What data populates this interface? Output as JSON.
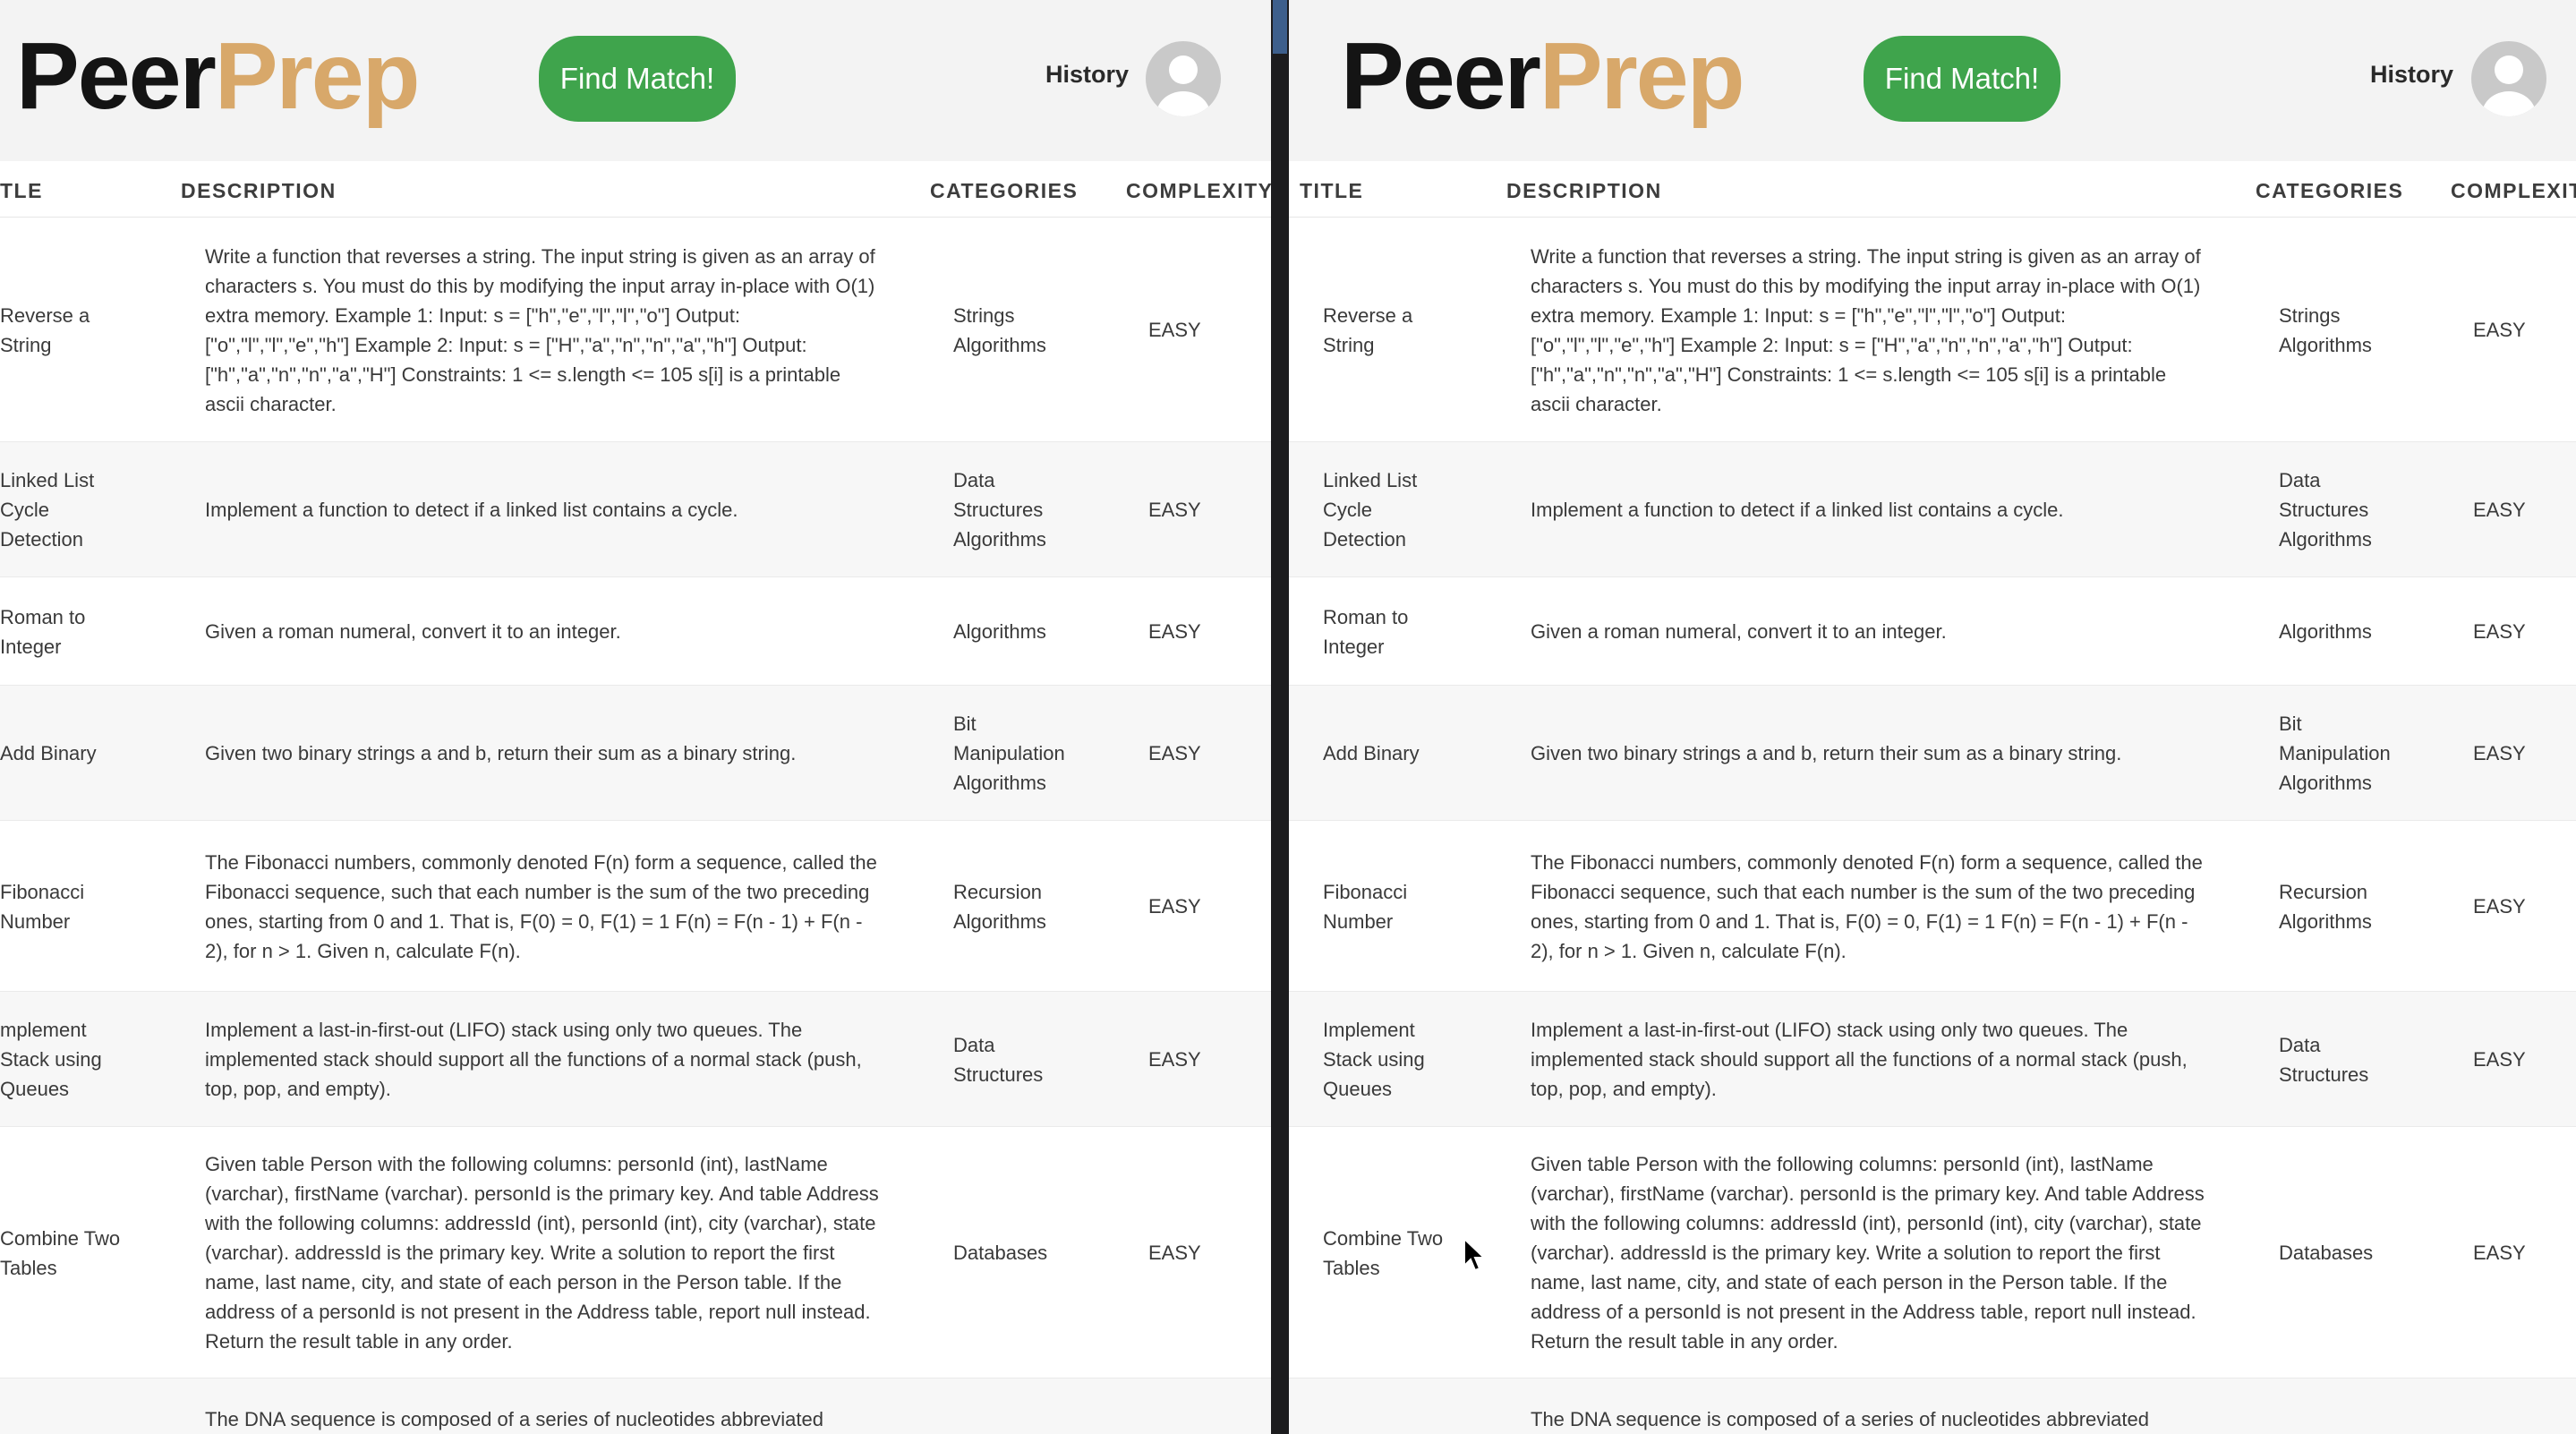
{
  "app": {
    "logo_part1": "Peer",
    "logo_part2": "Prep",
    "find_match_label": "Find Match!",
    "history_label": "History"
  },
  "columns": {
    "title": "TITLE",
    "title_left_cropped": "TLE",
    "description": "DESCRIPTION",
    "categories": "CATEGORIES",
    "complexity": "COMPLEXITY",
    "complexity_right_cropped": "COMPLEXIT"
  },
  "questions": [
    {
      "title": "Reverse a String",
      "title_left_cropped": "Reverse a String",
      "description": "Write a function that reverses a string. The input string is given as an array of characters s. You must do this by modifying the input array in-place with O(1) extra memory. Example 1: Input: s = [\"h\",\"e\",\"l\",\"l\",\"o\"] Output: [\"o\",\"l\",\"l\",\"e\",\"h\"] Example 2: Input: s = [\"H\",\"a\",\"n\",\"n\",\"a\",\"h\"] Output: [\"h\",\"a\",\"n\",\"n\",\"a\",\"H\"] Constraints: 1 <= s.length <= 105 s[i] is a printable ascii character.",
      "categories": "Strings Algorithms",
      "complexity": "EASY"
    },
    {
      "title": "Linked List Cycle Detection",
      "title_left_cropped": "Linked List Cycle Detection",
      "description": "Implement a function to detect if a linked list contains a cycle.",
      "categories": "Data Structures Algorithms",
      "complexity": "EASY"
    },
    {
      "title": "Roman to Integer",
      "title_left_cropped": "Roman to Integer",
      "description": "Given a roman numeral, convert it to an integer.",
      "categories": "Algorithms",
      "complexity": "EASY"
    },
    {
      "title": "Add Binary",
      "title_left_cropped": "Add Binary",
      "description": "Given two binary strings a and b, return their sum as a binary string.",
      "categories": "Bit Manipulation Algorithms",
      "complexity": "EASY"
    },
    {
      "title": "Fibonacci Number",
      "title_left_cropped": "Fibonacci Number",
      "description": "The Fibonacci numbers, commonly denoted F(n) form a sequence, called the Fibonacci sequence, such that each number is the sum of the two preceding ones, starting from 0 and 1. That is, F(0) = 0, F(1) = 1 F(n) = F(n - 1) + F(n - 2), for n > 1. Given n, calculate F(n).",
      "categories": "Recursion Algorithms",
      "complexity": "EASY"
    },
    {
      "title": "Implement Stack using Queues",
      "title_left_cropped": "mplement Stack using Queues",
      "description": "Implement a last-in-first-out (LIFO) stack using only two queues. The implemented stack should support all the functions of a normal stack (push, top, pop, and empty).",
      "categories": "Data Structures",
      "complexity": "EASY"
    },
    {
      "title": "Combine Two Tables",
      "title_left_cropped": "Combine Two Tables",
      "description": "Given table Person with the following columns: personId (int), lastName (varchar), firstName (varchar). personId is the primary key. And table Address with the following columns: addressId (int), personId (int), city (varchar), state (varchar). addressId is the primary key. Write a solution to report the first name, last name, city, and state of each person in the Person table. If the address of a personId is not present in the Address table, report null instead. Return the result table in any order.",
      "categories": "Databases",
      "complexity": "EASY"
    },
    {
      "title": "",
      "title_left_cropped": "",
      "description": "The DNA sequence is composed of a series of nucleotides abbreviated",
      "categories": "",
      "complexity": ""
    }
  ]
}
